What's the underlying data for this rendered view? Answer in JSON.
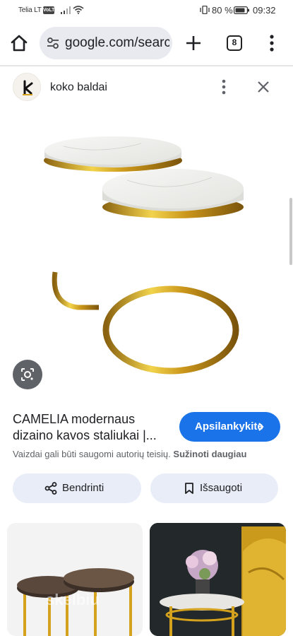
{
  "status_bar": {
    "carrier": "Telia LT",
    "network_badge": "VoLTE",
    "battery_percent": "80 %",
    "time": "09:32"
  },
  "browser": {
    "url": "google.com/search",
    "tab_count": "8",
    "icons": [
      "home-icon",
      "tune-icon",
      "plus-icon",
      "tabs-icon",
      "more-vert-icon"
    ]
  },
  "result": {
    "site_name": "koko baldai",
    "title": "CAMELIA modernaus dizaino kavos staliukai |...",
    "visit_label": "Apsilankykite",
    "copyright_notice": "Vaizdai gali būti saugomi autorių teisių.",
    "learn_more": "Sužinoti daugiau",
    "share_label": "Bendrinti",
    "save_label": "Išsaugoti"
  },
  "related": {
    "thumb_1_watermark": "skelbiu"
  },
  "colors": {
    "accent": "#1a73e8",
    "chip_bg": "#e8edf7",
    "url_bg": "#e8eaf0",
    "gold": "#d4a21c"
  }
}
